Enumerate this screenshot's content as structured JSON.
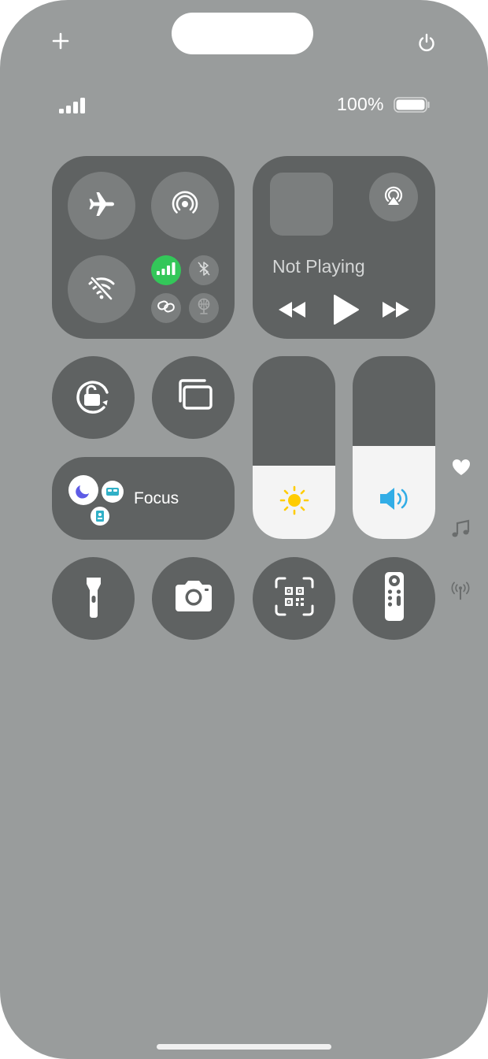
{
  "status_bar": {
    "battery_percent": "100%",
    "battery_level": 1.0,
    "signal_bars": 4
  },
  "header": {
    "add_icon": "plus-icon",
    "power_icon": "power-icon"
  },
  "connectivity": {
    "airplane_mode": {
      "icon": "airplane-icon",
      "on": false
    },
    "airdrop": {
      "icon": "airdrop-icon",
      "on": false
    },
    "wifi": {
      "icon": "wifi-off-icon",
      "on": false
    },
    "cellular": {
      "icon": "cellular-icon",
      "on": true,
      "color": "#33c759"
    },
    "bluetooth": {
      "icon": "bluetooth-off-icon",
      "on": false
    },
    "personal_hotspot": {
      "icon": "link-icon",
      "on": false
    },
    "satellite": {
      "icon": "globe-icon",
      "on": false
    }
  },
  "media": {
    "status": "Not Playing",
    "controls": [
      "rewind-icon",
      "play-icon",
      "fast-forward-icon"
    ]
  },
  "controls": {
    "orientation_lock": "rotation-lock-icon",
    "screen_mirroring": "screen-mirroring-icon",
    "focus": {
      "label": "Focus",
      "icons": [
        "moon-icon",
        "bed-icon",
        "id-badge-icon"
      ],
      "colors": {
        "moon": "#5e5ce6",
        "bed": "#30b0c7",
        "badge": "#30b0c7"
      }
    },
    "brightness": {
      "level": 0.4,
      "icon": "sun-icon",
      "color": "#ffcc00"
    },
    "volume": {
      "level": 0.51,
      "icon": "speaker-icon",
      "color": "#32ade6"
    }
  },
  "bottom_row": [
    "flashlight-icon",
    "camera-icon",
    "qr-scanner-icon",
    "remote-icon"
  ],
  "side_pages": [
    "heart-icon",
    "music-note-icon",
    "antenna-icon"
  ]
}
